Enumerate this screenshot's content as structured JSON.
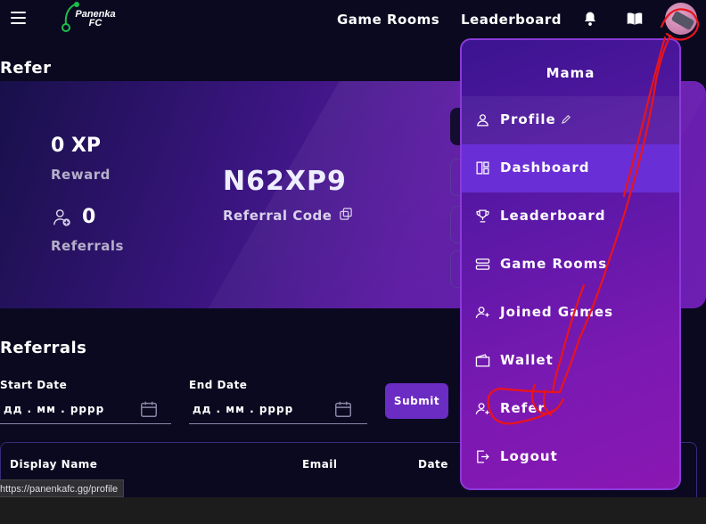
{
  "nav": {
    "logo_line1": "Panenka",
    "logo_line2": "FC",
    "links": [
      "Game Rooms",
      "Leaderboard"
    ]
  },
  "refer": {
    "section_title": "Refer",
    "xp": "0 XP",
    "reward_label": "Reward",
    "referral_count": "0",
    "referrals_label": "Referrals",
    "code": "N62XP9",
    "code_label": "Referral Code"
  },
  "referrals": {
    "section_title": "Referrals",
    "start_label": "Start Date",
    "end_label": "End Date",
    "date_placeholder": "дд . мм . рррр",
    "submit_label": "Submit",
    "columns": [
      "Display Name",
      "Email",
      "Date"
    ]
  },
  "status_url": "https://panenkafc.gg/profile",
  "menu": {
    "user_name": "Mama",
    "items": [
      {
        "label": "Profile",
        "icon": "user-icon"
      },
      {
        "label": "Dashboard",
        "icon": "dashboard-icon"
      },
      {
        "label": "Leaderboard",
        "icon": "trophy-icon"
      },
      {
        "label": "Game Rooms",
        "icon": "server-icon"
      },
      {
        "label": "Joined Games",
        "icon": "user-plus-icon"
      },
      {
        "label": "Wallet",
        "icon": "wallet-icon"
      },
      {
        "label": "Refer",
        "icon": "refer-icon"
      },
      {
        "label": "Logout",
        "icon": "logout-icon"
      }
    ],
    "active_index": 1
  },
  "colors": {
    "accent": "#6a2ed6",
    "menu_border": "#8b3ad8",
    "annotation": "#e8141c"
  }
}
